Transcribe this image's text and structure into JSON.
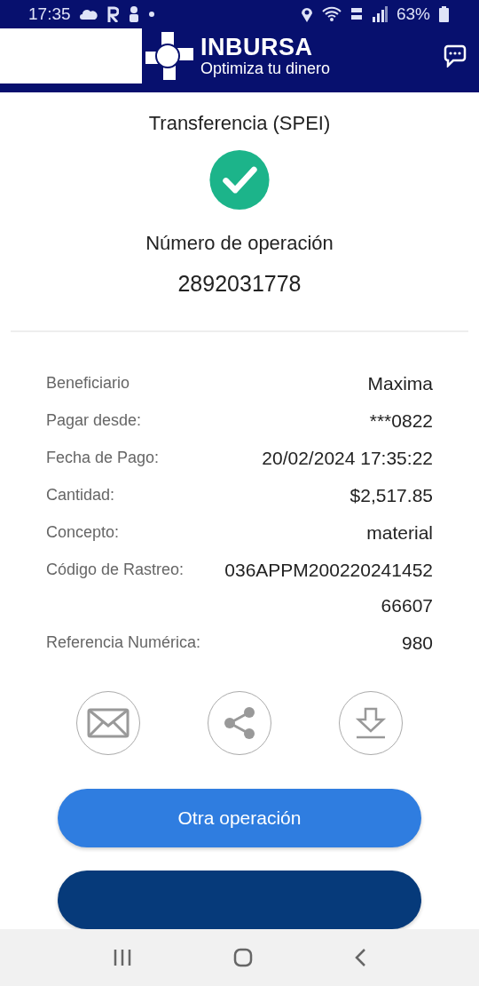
{
  "status_bar": {
    "time": "17:35",
    "battery": "63%"
  },
  "header": {
    "brand": "INBURSA",
    "tagline": "Optimiza tu dinero"
  },
  "receipt": {
    "title": "Transferencia (SPEI)",
    "operation_label": "Número de operación",
    "operation_number": "2892031778"
  },
  "details": [
    {
      "label": "Beneficiario",
      "value": [
        "Maxima"
      ]
    },
    {
      "label": "Pagar desde:",
      "value": [
        "***0822"
      ]
    },
    {
      "label": "Fecha de Pago:",
      "value": [
        "20/02/2024 17:35:22"
      ]
    },
    {
      "label": "Cantidad:",
      "value": [
        "$2,517.85"
      ]
    },
    {
      "label": "Concepto:",
      "value": [
        "material"
      ]
    },
    {
      "label": "Código de Rastreo:",
      "value": [
        "036APPM200220241452",
        "66607"
      ]
    },
    {
      "label": "Referencia Numérica:",
      "value": [
        "980"
      ]
    }
  ],
  "actions": [
    {
      "kind": "email"
    },
    {
      "kind": "share"
    },
    {
      "kind": "download"
    }
  ],
  "buttons": [
    {
      "label": "Otra operación",
      "kind": "primary"
    },
    {
      "kind": "secondary"
    }
  ]
}
